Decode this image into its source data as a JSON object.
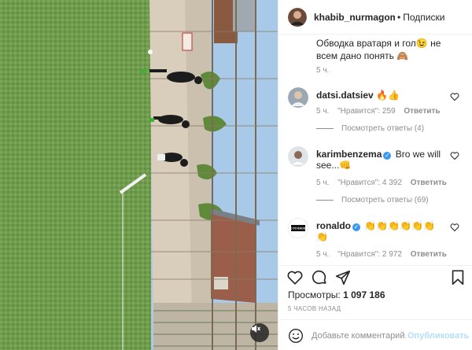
{
  "post": {
    "author": "khabib_nurmagomedov",
    "separator": "•",
    "follow_label": "Подписки"
  },
  "caption": {
    "text": "Обводка вратаря и гол😉 не всем дано понять 🙈",
    "time": "5 ч."
  },
  "comments": [
    {
      "user": "datsi.datsiev",
      "verified": false,
      "text": "🔥👍",
      "time": "5 ч.",
      "likes": "\"Нравится\": 259",
      "reply_label": "Ответить",
      "view_replies": "Посмотреть ответы (4)"
    },
    {
      "user": "karimbenzema",
      "verified": true,
      "text": "Bro we will see...👊",
      "time": "5 ч.",
      "likes": "\"Нравится\": 4 392",
      "reply_label": "Ответить",
      "view_replies": "Посмотреть ответы (69)"
    },
    {
      "user": "ronaldo",
      "verified": true,
      "text": "👏👏👏👏👏👏👏",
      "time": "5 ч.",
      "likes": "\"Нравится\": 2 972",
      "reply_label": "Ответить",
      "avatar_text": "NO TO RACISM"
    }
  ],
  "icons": {
    "like": "heart-icon",
    "comment": "comment-icon",
    "share": "share-icon",
    "save": "bookmark-icon",
    "emoji": "emoji-icon",
    "mute": "speaker-muted-icon"
  },
  "stats": {
    "views_label": "Просмотры:",
    "views_value": "1 097 186",
    "posted": "5 ЧАСОВ НАЗАД"
  },
  "composer": {
    "placeholder": "Добавьте комментарий...",
    "publish_label": "Опубликовать"
  },
  "colors": {
    "verified": "#3897f0",
    "publish_disabled": "#b2dffc",
    "muted_text": "#8e8e8e"
  }
}
